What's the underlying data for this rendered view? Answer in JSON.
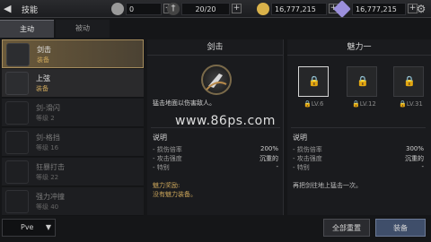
{
  "header": {
    "title": "技能",
    "back_icon": "back-arrow-icon",
    "settings_icon": "gear-icon"
  },
  "resources": [
    {
      "name": "coin",
      "value": "0",
      "icon": "coin-icon",
      "color": "#c9c9c9"
    },
    {
      "name": "stamina",
      "value": "20/20",
      "icon": "sword-icon",
      "color": "#dcdcdc"
    },
    {
      "name": "gold",
      "value": "16,777,215",
      "icon": "gold-coin-icon",
      "color": "#d9b24a"
    },
    {
      "name": "crystal",
      "value": "16,777,215",
      "icon": "crystal-icon",
      "color": "#9b8fdc"
    }
  ],
  "tabs": [
    {
      "label": "主动"
    },
    {
      "label": "被动"
    }
  ],
  "skills": [
    {
      "name": "剑击",
      "status": "装备",
      "state": "selected"
    },
    {
      "name": "上弦",
      "status": "装备",
      "state": "equipped"
    },
    {
      "name": "剑-滑闪",
      "status": "等级 2",
      "state": "locked"
    },
    {
      "name": "剑-格挡",
      "status": "等级 16",
      "state": "locked"
    },
    {
      "name": "狂暴打击",
      "status": "等级 22",
      "state": "locked"
    },
    {
      "name": "强力冲撞",
      "status": "等级 40",
      "state": "locked"
    }
  ],
  "mode_select": {
    "value": "Pve"
  },
  "detail": {
    "title": "剑击",
    "description": "猛击地面以伤害敌人。",
    "section": "说明",
    "stats": [
      {
        "label": "- 损伤倍率",
        "value": "200%"
      },
      {
        "label": "- 攻击强度",
        "value": "沉重的"
      },
      {
        "label": "- 特别",
        "value": "-"
      }
    ],
    "bonus_title": "魅力奖励:",
    "bonus_text": "没有魅力装备。"
  },
  "charm": {
    "title": "魅力一",
    "slots": [
      {
        "label": "LV.6"
      },
      {
        "label": "LV.12"
      },
      {
        "label": "LV.31"
      }
    ],
    "section": "说明",
    "stats": [
      {
        "label": "- 损伤倍率",
        "value": "300%"
      },
      {
        "label": "- 攻击强度",
        "value": "沉重的"
      },
      {
        "label": "- 特别",
        "value": "-"
      }
    ],
    "note": "再把剑往地上猛击一次。"
  },
  "buttons": {
    "reset": "全部重置",
    "equip": "装备"
  },
  "watermark": "www.86ps.com"
}
